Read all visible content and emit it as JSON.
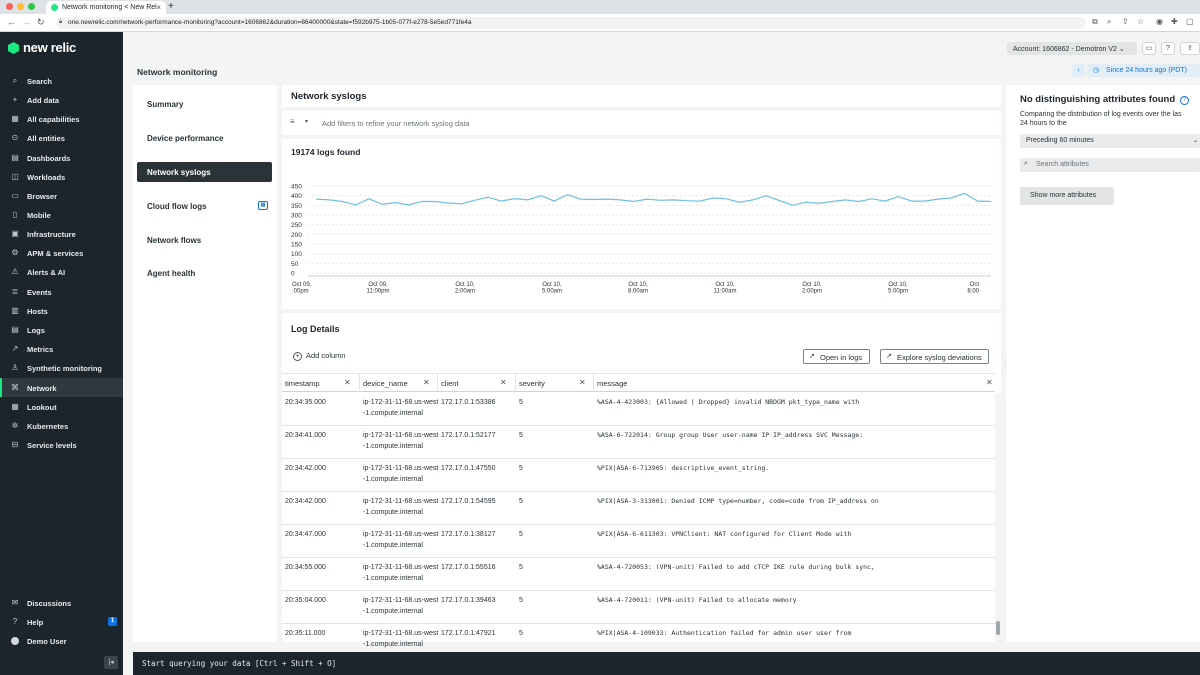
{
  "browser": {
    "tab_title": "Network monitoring < New Rel",
    "url": "one.newrelic.com/network-performance-monitoring?account=1606862&duration=86400000&state=f592b975-1b05-077f-e278-5e5ed771fe4a"
  },
  "sidebar": {
    "logo": "new relic",
    "items": [
      {
        "label": "Search",
        "icon": "search-icon"
      },
      {
        "label": "Add data",
        "icon": "plus-icon"
      },
      {
        "label": "All capabilities",
        "icon": "grid-icon"
      },
      {
        "label": "All entities",
        "icon": "entities-icon"
      },
      {
        "label": "Dashboards",
        "icon": "dashboard-icon"
      },
      {
        "label": "Workloads",
        "icon": "workloads-icon"
      },
      {
        "label": "Browser",
        "icon": "browser-icon"
      },
      {
        "label": "Mobile",
        "icon": "mobile-icon"
      },
      {
        "label": "Infrastructure",
        "icon": "infrastructure-icon"
      },
      {
        "label": "APM & services",
        "icon": "apm-icon"
      },
      {
        "label": "Alerts & AI",
        "icon": "alert-icon"
      },
      {
        "label": "Events",
        "icon": "events-icon"
      },
      {
        "label": "Hosts",
        "icon": "hosts-icon"
      },
      {
        "label": "Logs",
        "icon": "logs-icon"
      },
      {
        "label": "Metrics",
        "icon": "metrics-icon"
      },
      {
        "label": "Synthetic monitoring",
        "icon": "synthetics-icon"
      },
      {
        "label": "Network",
        "icon": "network-icon"
      },
      {
        "label": "Lookout",
        "icon": "lookout-icon"
      },
      {
        "label": "Kubernetes",
        "icon": "kubernetes-icon"
      },
      {
        "label": "Service levels",
        "icon": "service-levels-icon"
      }
    ],
    "bottom": [
      {
        "label": "Discussions",
        "icon": "discussions-icon"
      },
      {
        "label": "Help",
        "icon": "help-icon",
        "badge": "1"
      },
      {
        "label": "Demo User",
        "icon": "user-avatar-icon"
      }
    ]
  },
  "header": {
    "page_title": "Network monitoring",
    "account": "Account: 1606862 - Demotron V2",
    "time_range": "Since 24 hours ago (PDT)"
  },
  "subnav": {
    "items": [
      "Summary",
      "Device performance",
      "Network syslogs",
      "Cloud flow logs",
      "Network flows",
      "Agent health"
    ]
  },
  "syslogs": {
    "title": "Network syslogs",
    "filter_placeholder": "Add filters to refine your network syslog data"
  },
  "chart_data": {
    "type": "line",
    "title": "19174 logs found",
    "ylim": [
      0,
      450
    ],
    "yticks": [
      0,
      50,
      100,
      150,
      200,
      250,
      300,
      350,
      400,
      450
    ],
    "xticks": [
      [
        "Oct 09,",
        ":00pm"
      ],
      [
        "Oct 09,",
        "11:00pm"
      ],
      [
        "Oct 10,",
        "2:00am"
      ],
      [
        "Oct 10,",
        "5:00am"
      ],
      [
        "Oct 10,",
        "8:00am"
      ],
      [
        "Oct 10,",
        "11:00am"
      ],
      [
        "Oct 10,",
        "2:00pm"
      ],
      [
        "Oct 10,",
        "5:00pm"
      ],
      [
        "Oct",
        "8:00"
      ]
    ],
    "line_color": "#6fbfe0",
    "values": [
      382,
      378,
      370,
      352,
      384,
      356,
      364,
      352,
      370,
      370,
      362,
      358,
      376,
      392,
      372,
      385,
      378,
      400,
      372,
      405,
      382,
      380,
      382,
      378,
      370,
      382,
      376,
      378,
      374,
      372,
      388,
      384,
      366,
      378,
      400,
      375,
      350,
      366,
      360,
      370,
      378,
      370,
      384,
      372,
      395,
      372,
      372,
      382,
      388,
      412,
      372,
      370
    ]
  },
  "log_details": {
    "title": "Log Details",
    "add_column": "Add column",
    "open_in_logs": "Open in logs",
    "explore": "Explore syslog deviations",
    "columns": [
      "timestamp",
      "device_name",
      "client",
      "severity",
      "message"
    ],
    "rows": [
      {
        "timestamp": "20:34:35.000",
        "device": "ip-172-31-11-68.us-west-1.compute.internal",
        "client": "172.17.0.1:53386",
        "severity": "5",
        "message": "%ASA-4-423003: {Allowed | Dropped} invalid NBDGM pkt_type_name with"
      },
      {
        "timestamp": "20:34:41.000",
        "device": "ip-172-31-11-68.us-west-1.compute.internal",
        "client": "172.17.0.1:52177",
        "severity": "5",
        "message": "%ASA-6-722014: Group group User user-name IP IP_address SVC Message:"
      },
      {
        "timestamp": "20:34:42.000",
        "device": "ip-172-31-11-68.us-west-1.compute.internal",
        "client": "172.17.0.1:47550",
        "severity": "5",
        "message": "%PIX|ASA-6-713905: descriptive_event_string."
      },
      {
        "timestamp": "20:34:42.000",
        "device": "ip-172-31-11-68.us-west-1.compute.internal",
        "client": "172.17.0.1:54595",
        "severity": "5",
        "message": "%PIX|ASA-3-313001: Denied ICMP type=number, code=code from IP_address on"
      },
      {
        "timestamp": "20:34:47.000",
        "device": "ip-172-31-11-68.us-west-1.compute.internal",
        "client": "172.17.0.1:38127",
        "severity": "5",
        "message": "%PIX|ASA-6-611303: VPNClient: NAT configured for Client Mode with"
      },
      {
        "timestamp": "20:34:55.000",
        "device": "ip-172-31-11-68.us-west-1.compute.internal",
        "client": "172.17.0.1:55516",
        "severity": "5",
        "message": "%ASA-4-720053: (VPN-unit) Failed to add cTCP IKE rule during bulk sync,"
      },
      {
        "timestamp": "20:35:04.000",
        "device": "ip-172-31-11-68.us-west-1.compute.internal",
        "client": "172.17.0.1:39463",
        "severity": "5",
        "message": "%ASA-4-720011: (VPN-unit) Failed to allocate memory"
      },
      {
        "timestamp": "20:35:11.000",
        "device": "ip-172-31-11-68.us-west-1.compute.internal",
        "client": "172.17.0.1:47921",
        "severity": "5",
        "message": "%PIX|ASA-4-109033: Authentication failed for admin user user from"
      }
    ]
  },
  "attributes": {
    "title": "No distinguishing attributes found",
    "desc_line1": "Comparing the distribution of log events over the las",
    "desc_line2": "24 hours to the",
    "period": "Preceding 60 minutes",
    "search_placeholder": "Search attributes",
    "more_button": "Show more attributes"
  },
  "query_bar": {
    "text": "Start querying your data [Ctrl + Shift + O]"
  }
}
